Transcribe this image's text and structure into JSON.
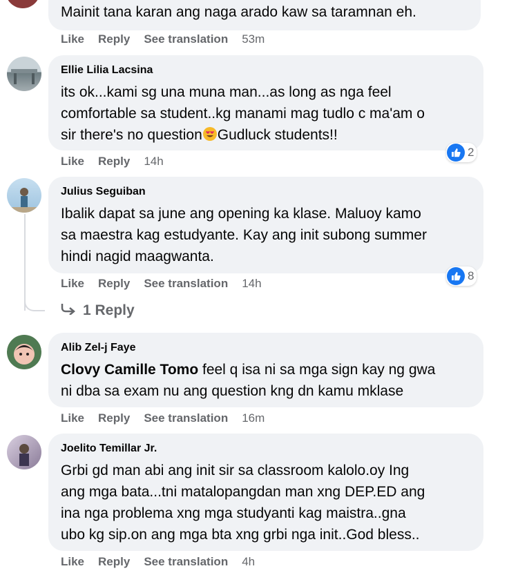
{
  "actions": {
    "like": "Like",
    "reply": "Reply",
    "see_translation": "See translation"
  },
  "comments": [
    {
      "text": "Mainit tana karan ang naga arado kaw sa taramnan eh.",
      "time": "53m",
      "has_translation": true
    },
    {
      "author": "Ellie Lilia Lacsina",
      "text": "its ok...kami sg una muna man...as long as nga feel\ncomfortable sa student..kg manami mag tudlo c ma'am o\nsir there's no question",
      "text_after_emoji": "Gudluck students!!",
      "emoji": "heart-eyes",
      "time": "14h",
      "reactions": "2"
    },
    {
      "author": "Julius Seguiban",
      "text": "Ibalik dapat sa june ang opening ka klase. Maluoy kamo\nsa maestra kag estudyante. Kay ang init subong summer\nhindi nagid maagwanta.",
      "time": "14h",
      "reactions": "8",
      "replies_label": "1 Reply"
    },
    {
      "author": "Alib Zel-j Faye",
      "mention": "Clovy Camille Tomo",
      "text": " feel q isa ni sa mga sign kay ng gwa\nni dba sa exam nu ang question kng dn kamu mklase",
      "time": "16m"
    },
    {
      "author": "Joelito Temillar Jr.",
      "text": "Grbi gd man abi ang init sir sa classroom kalolo.oy Ing\nang mga bata...tni matalopangdan man xng DEP.ED ang\nina nga problema xng mga studyanti kag maistra..gna\nubo kg sip.on ang mga bta xng grbi nga init..God bless..",
      "time": "4h"
    }
  ],
  "colors": {
    "bubble": "#f0f2f5",
    "secondary_text": "#65676b",
    "like_blue": "#1877f2"
  }
}
